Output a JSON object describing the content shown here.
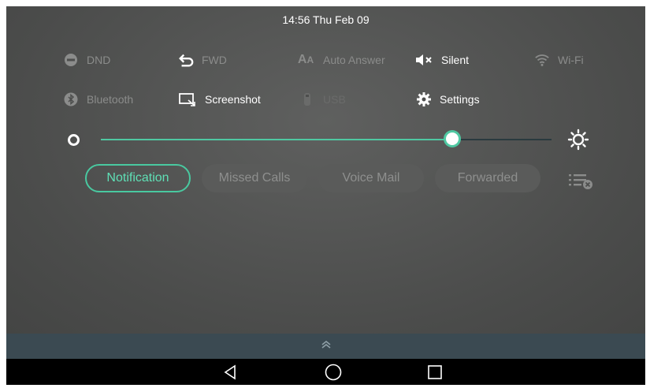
{
  "status": {
    "datetime": "14:56 Thu Feb 09"
  },
  "quick_settings": {
    "row1": [
      {
        "label": "DND",
        "icon": "dnd-icon",
        "state": "off"
      },
      {
        "label": "FWD",
        "icon": "forward-icon",
        "state": "off"
      },
      {
        "label": "Auto Answer",
        "icon": "auto-answer-icon",
        "state": "off"
      },
      {
        "label": "Silent",
        "icon": "silent-icon",
        "state": "on"
      },
      {
        "label": "Wi-Fi",
        "icon": "wifi-icon",
        "state": "off"
      }
    ],
    "row2": [
      {
        "label": "Bluetooth",
        "icon": "bluetooth-icon",
        "state": "off"
      },
      {
        "label": "Screenshot",
        "icon": "screenshot-icon",
        "state": "on"
      },
      {
        "label": "USB",
        "icon": "usb-icon",
        "state": "disabled"
      },
      {
        "label": "Settings",
        "icon": "settings-icon",
        "state": "on"
      }
    ]
  },
  "brightness": {
    "value_percent": 78,
    "accent": "#4fc8a2"
  },
  "tabs": [
    {
      "label": "Notification",
      "active": true
    },
    {
      "label": "Missed Calls",
      "active": false
    },
    {
      "label": "Voice Mail",
      "active": false
    },
    {
      "label": "Forwarded",
      "active": false
    }
  ],
  "icons": {
    "clear_all": "clear-all-icon",
    "handle": "collapse-handle-icon",
    "nav": [
      "back-icon",
      "home-icon",
      "recents-icon"
    ]
  }
}
